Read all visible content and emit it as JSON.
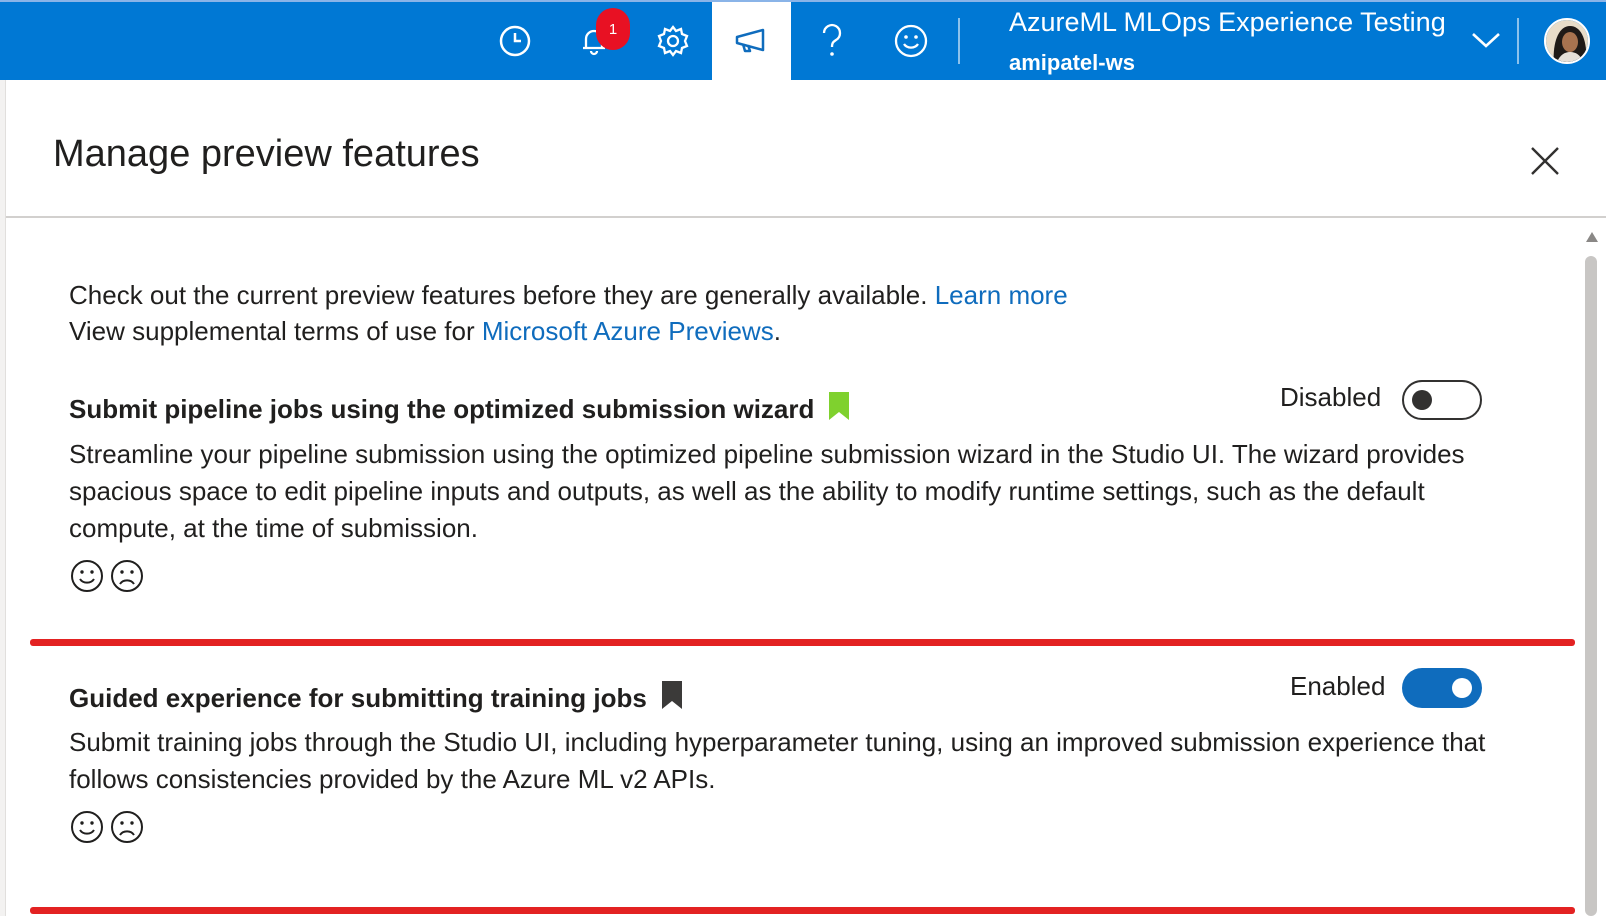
{
  "topbar": {
    "icons": [
      "history-icon",
      "notification-bell-icon",
      "settings-gear-icon",
      "megaphone-icon",
      "help-icon",
      "feedback-smile-icon"
    ],
    "notification_count": "1",
    "workspace_title": "AzureML MLOps Experience Testing",
    "workspace_name": "amipatel-ws",
    "accent_color": "#0078d4"
  },
  "panel": {
    "title": "Manage preview features",
    "intro_line1": "Check out the current preview features before they are generally available.",
    "intro_link1": "Learn more",
    "intro_line2": "View supplemental terms of use for",
    "intro_link2": "Microsoft Azure Previews",
    "intro_line2_end": "."
  },
  "features": [
    {
      "title": "Submit pipeline jobs using the optimized submission wizard",
      "bookmark_color": "#7fd12e",
      "status_label": "Disabled",
      "enabled": false,
      "description": "Streamline your pipeline submission using the optimized pipeline submission wizard in the Studio UI. The wizard provides spacious space to edit pipeline inputs and outputs, as well as the ability to modify runtime settings, such as the default compute, at the time of submission."
    },
    {
      "title": "Guided experience for submitting training jobs",
      "bookmark_color": "#3b3a39",
      "status_label": "Enabled",
      "enabled": true,
      "description": "Submit training jobs through the Studio UI, including hyperparameter tuning, using an improved submission experience that follows consistencies provided by the Azure ML v2 APIs."
    }
  ]
}
